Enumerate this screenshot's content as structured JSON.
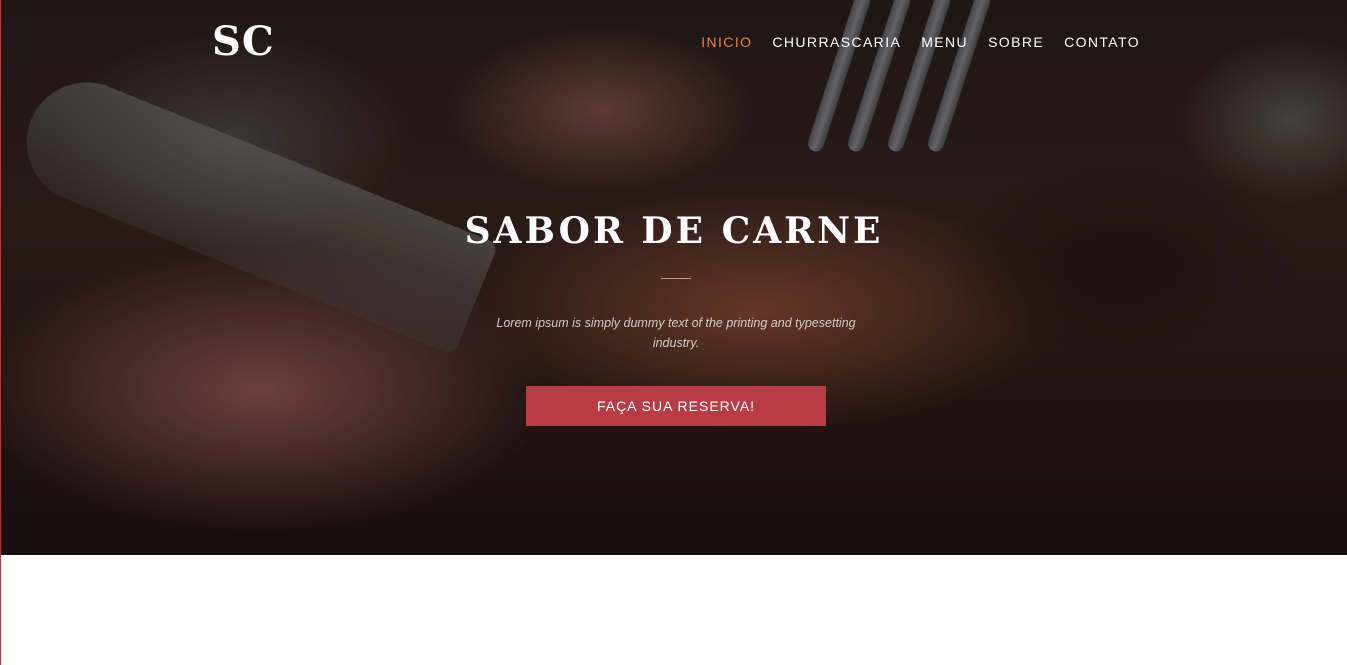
{
  "brand": {
    "logo_text": "SC"
  },
  "nav": {
    "items": [
      {
        "label": "INICIO",
        "active": true
      },
      {
        "label": "CHURRASCARIA",
        "active": false
      },
      {
        "label": "MENU",
        "active": false
      },
      {
        "label": "SOBRE",
        "active": false
      },
      {
        "label": "CONTATO",
        "active": false
      }
    ]
  },
  "hero": {
    "title": "SABOR DE CARNE",
    "subtitle": "Lorem ipsum is simply dummy text of the printing and typesetting industry.",
    "cta_label": "FAÇA SUA RESERVA!"
  },
  "colors": {
    "accent_nav_active": "#e8833a",
    "cta_background": "#b73c45",
    "page_background": "#ffffff"
  }
}
